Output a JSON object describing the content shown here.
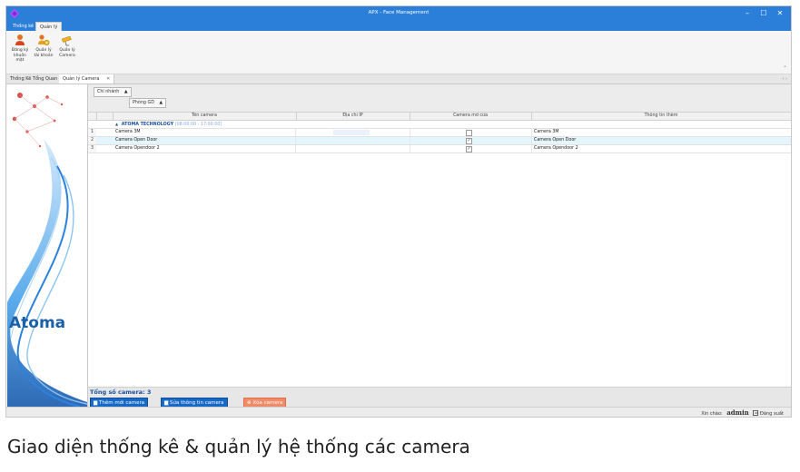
{
  "window": {
    "title": "APX - Face Management",
    "minimize_glyph": "–",
    "maximize_glyph": "☐",
    "close_glyph": "✕"
  },
  "ribbon_tabs": [
    "Thống kê",
    "Quản lý"
  ],
  "ribbon_buttons": [
    {
      "label_line1": "Đăng ký",
      "label_line2": "khuôn mặt",
      "icon": "person-register-icon"
    },
    {
      "label_line1": "Quản lý",
      "label_line2": "tài khoản",
      "icon": "user-gear-icon"
    },
    {
      "label_line1": "Quản lý",
      "label_line2": "Camera",
      "icon": "camera-icon"
    }
  ],
  "ribbon_collapse_glyph": "⌃",
  "doc_tabs": [
    {
      "label": "Thống Kê Tổng Quan"
    },
    {
      "label": "Quản lý Camera",
      "close_glyph": "✕"
    }
  ],
  "doc_nav_glyph": "‹ ›",
  "sidebar": {
    "brand": "Atoma"
  },
  "group_panel": {
    "chips": [
      {
        "label": "Chi nhánh",
        "sort_glyph": "▲"
      },
      {
        "label": "Phòng GD",
        "sort_glyph": "▲"
      }
    ]
  },
  "grid": {
    "columns": [
      "Tên camera",
      "Địa chỉ IP",
      "Camera mở cửa",
      "Thông tin thêm"
    ],
    "group": {
      "expand_glyph": "▲",
      "name": "ATOMA TECHNOLOGY",
      "time": "[08:00:00 - 17:00:00]"
    },
    "rows": [
      {
        "num": "1",
        "name": "Camera 3M",
        "ip": "",
        "open_door": false,
        "info": "Camera 3M"
      },
      {
        "num": "2",
        "name": "Camera Open Door",
        "ip": "",
        "open_door": true,
        "info": "Camera Open Door"
      },
      {
        "num": "3",
        "name": "Camera Opendoor 2",
        "ip": "",
        "open_door": true,
        "info": "Camera Opendoor 2"
      }
    ]
  },
  "footer": {
    "total": "Tổng số camera: 3",
    "buttons": {
      "add": "Thêm mới camera",
      "edit": "Sửa thông tin camera",
      "delete": "Xóa camera"
    }
  },
  "statusbar": {
    "greeting": "Xin chào:",
    "user": "admin",
    "logout": "Đăng xuất"
  },
  "caption": "Giao diện thống kê & quản lý hệ thống các camera",
  "colors": {
    "title_bar": "#2b7fd9",
    "group_text": "#1a4f9c",
    "zebra": "#e4f5fb",
    "delete_button": "#f08b6a"
  }
}
